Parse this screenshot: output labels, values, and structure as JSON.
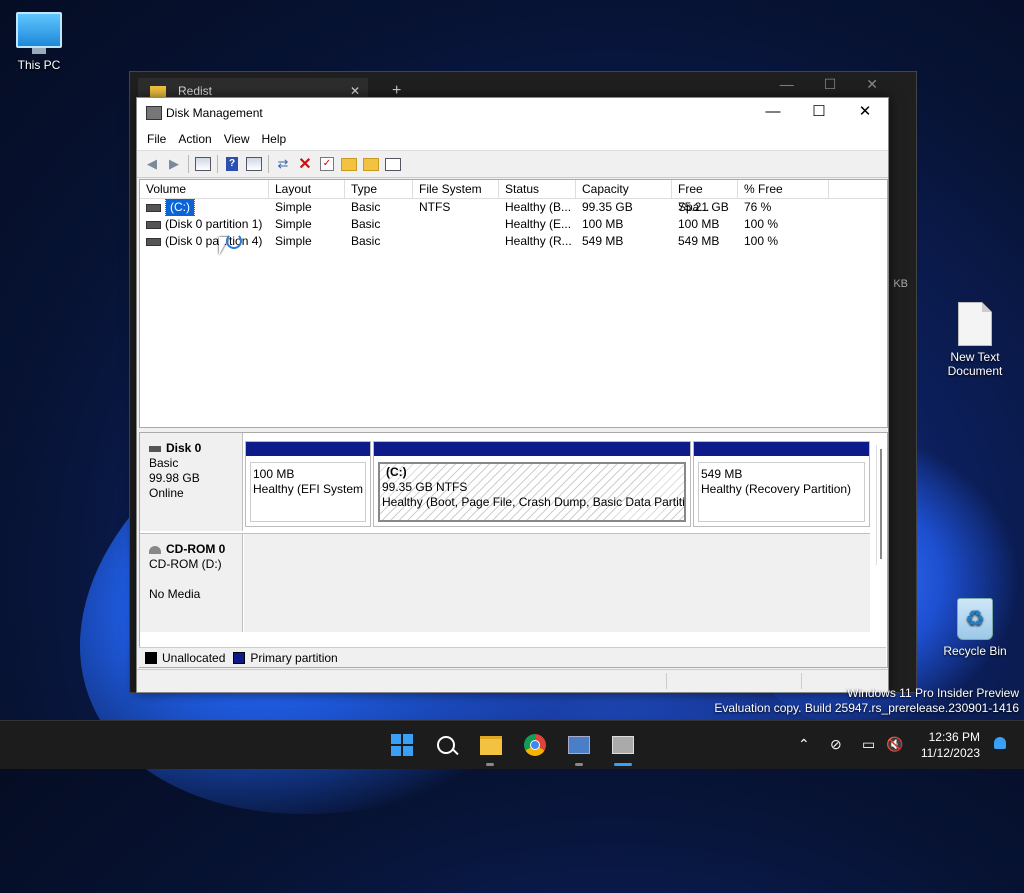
{
  "desktop": {
    "icons": [
      {
        "label": "This PC"
      },
      {
        "label": "New Text Document"
      },
      {
        "label": "Recycle Bin"
      }
    ],
    "watermark": {
      "line1": "Windows 11 Pro Insider Preview",
      "line2": "Evaluation copy. Build 25947.rs_prerelease.230901-1416"
    }
  },
  "background_window": {
    "tab_label": "Redist",
    "side_text": "KB"
  },
  "window": {
    "title": "Disk Management",
    "menu": [
      "File",
      "Action",
      "View",
      "Help"
    ],
    "toolbar_icons": [
      "back-icon",
      "forward-icon",
      "properties-grid-icon",
      "help-icon",
      "view-grid-icon",
      "connect-icon",
      "delete-icon",
      "check-icon",
      "folder-up-icon",
      "folder-search-icon",
      "list-icon"
    ]
  },
  "volume_list": {
    "columns": [
      "Volume",
      "Layout",
      "Type",
      "File System",
      "Status",
      "Capacity",
      "Free Spa...",
      "% Free"
    ],
    "rows": [
      {
        "volume": "(C:)",
        "layout": "Simple",
        "type": "Basic",
        "fs": "NTFS",
        "status": "Healthy (B...",
        "capacity": "99.35 GB",
        "free": "75.21 GB",
        "pct": "76 %"
      },
      {
        "volume": "(Disk 0 partition 1)",
        "layout": "Simple",
        "type": "Basic",
        "fs": "",
        "status": "Healthy (E...",
        "capacity": "100 MB",
        "free": "100 MB",
        "pct": "100 %"
      },
      {
        "volume": "(Disk 0 partition 4)",
        "layout": "Simple",
        "type": "Basic",
        "fs": "",
        "status": "Healthy (R...",
        "capacity": "549 MB",
        "free": "549 MB",
        "pct": "100 %"
      }
    ]
  },
  "disks": [
    {
      "name": "Disk 0",
      "kind": "Basic",
      "size": "99.98 GB",
      "state": "Online",
      "partitions": [
        {
          "title": "",
          "size": "100 MB",
          "status": "Healthy (EFI System P"
        },
        {
          "title": "(C:)",
          "size": "99.35 GB NTFS",
          "status": "Healthy (Boot, Page File, Crash Dump, Basic Data Partitior"
        },
        {
          "title": "",
          "size": "549 MB",
          "status": "Healthy (Recovery Partition)"
        }
      ]
    },
    {
      "name": "CD-ROM 0",
      "kind": "CD-ROM (D:)",
      "size": "",
      "state": "No Media"
    }
  ],
  "legend": [
    {
      "label": "Unallocated",
      "color": "#000000"
    },
    {
      "label": "Primary partition",
      "color": "#0c1a8a"
    }
  ],
  "taskbar": {
    "time": "12:36 PM",
    "date": "11/12/2023"
  }
}
